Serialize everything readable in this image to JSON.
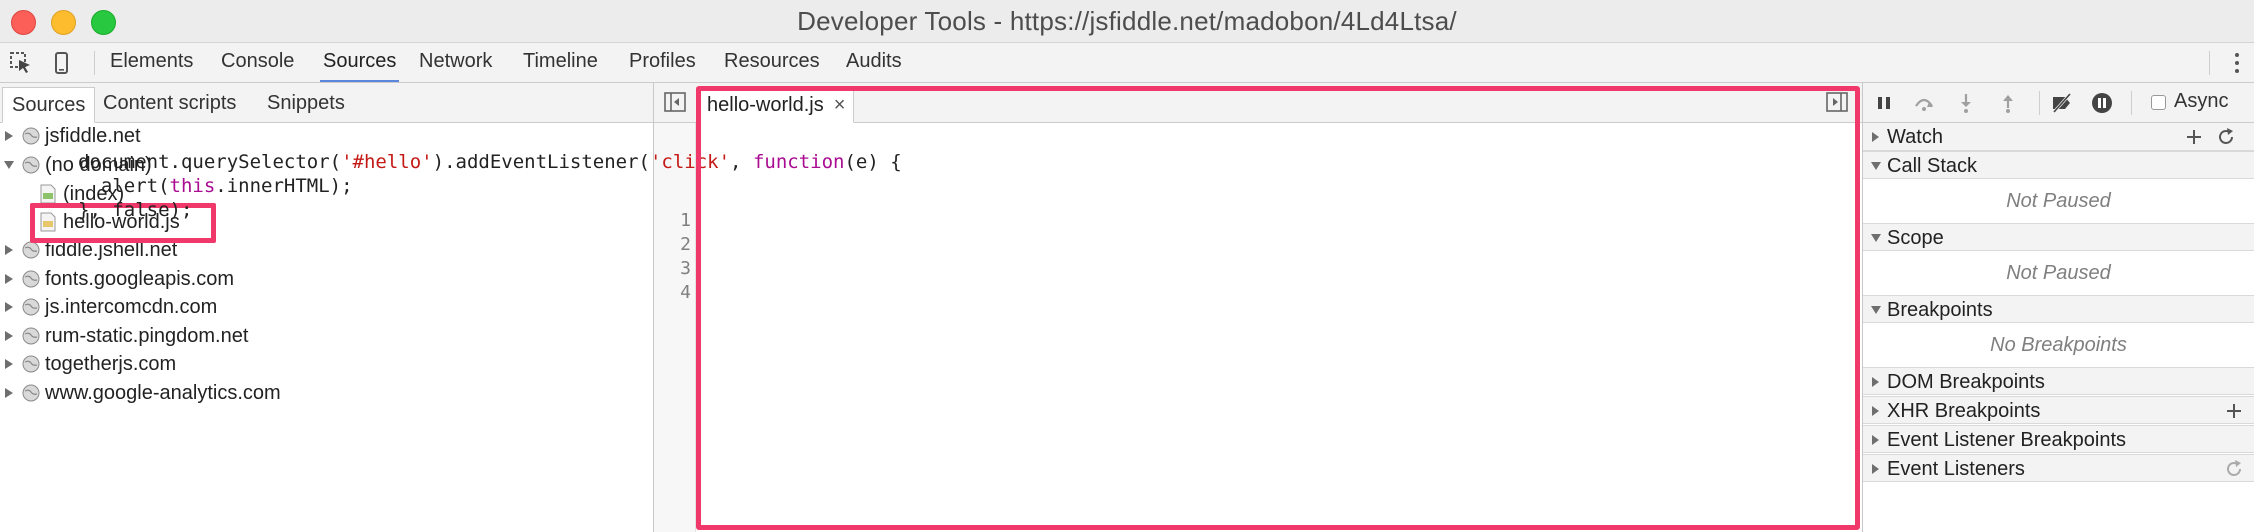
{
  "window": {
    "title": "Developer Tools - https://jsfiddle.net/madobon/4Ld4Ltsa/"
  },
  "toolbar": {
    "icons": [
      "inspect-element-icon",
      "device-mode-icon",
      "more-options-icon"
    ],
    "tabs": [
      {
        "label": "Elements"
      },
      {
        "label": "Console"
      },
      {
        "label": "Sources"
      },
      {
        "label": "Network"
      },
      {
        "label": "Timeline"
      },
      {
        "label": "Profiles"
      },
      {
        "label": "Resources"
      },
      {
        "label": "Audits"
      }
    ],
    "active_tab": "Sources"
  },
  "navigator": {
    "tabs": [
      {
        "label": "Sources"
      },
      {
        "label": "Content scripts"
      },
      {
        "label": "Snippets"
      }
    ],
    "tree": [
      {
        "label": "jsfiddle.net",
        "icon": "globe-icon",
        "expanded": false
      },
      {
        "label": "(no domain)",
        "icon": "globe-icon",
        "expanded": true
      },
      {
        "label": "(index)",
        "icon": "html-file-icon"
      },
      {
        "label": "hello-world.js",
        "icon": "js-file-icon",
        "selected": true
      },
      {
        "label": "fiddle.jshell.net",
        "icon": "globe-icon",
        "expanded": false
      },
      {
        "label": "fonts.googleapis.com",
        "icon": "globe-icon",
        "expanded": false
      },
      {
        "label": "js.intercomcdn.com",
        "icon": "globe-icon",
        "expanded": false
      },
      {
        "label": "rum-static.pingdom.net",
        "icon": "globe-icon",
        "expanded": false
      },
      {
        "label": "togetherjs.com",
        "icon": "globe-icon",
        "expanded": false
      },
      {
        "label": "www.google-analytics.com",
        "icon": "globe-icon",
        "expanded": false
      }
    ]
  },
  "editor": {
    "file_tab": {
      "label": "hello-world.js",
      "close": "×"
    },
    "line_numbers": [
      "1",
      "2",
      "3",
      "4"
    ],
    "code": {
      "l1_a": "document.querySelector(",
      "l1_str1": "'#hello'",
      "l1_b": ").addEventListener(",
      "l1_str2": "'click'",
      "l1_c": ", ",
      "l1_kw": "function",
      "l1_d": "(e) {",
      "l2_a": "  alert(",
      "l2_kw": "this",
      "l2_b": ".innerHTML);",
      "l3": "}, false);"
    }
  },
  "debugger": {
    "async_label": "Async",
    "panes": {
      "watch": "Watch",
      "call_stack": "Call Stack",
      "call_stack_body": "Not Paused",
      "scope": "Scope",
      "scope_body": "Not Paused",
      "breakpoints": "Breakpoints",
      "breakpoints_body": "No Breakpoints",
      "dom_breakpoints": "DOM Breakpoints",
      "xhr_breakpoints": "XHR Breakpoints",
      "event_listener_breakpoints": "Event Listener Breakpoints",
      "event_listeners": "Event Listeners"
    }
  },
  "colors": {
    "highlight": "#f0386a",
    "active_tab_underline": "#5a87dc",
    "string": "#c41a16",
    "keyword": "#aa0d91"
  }
}
